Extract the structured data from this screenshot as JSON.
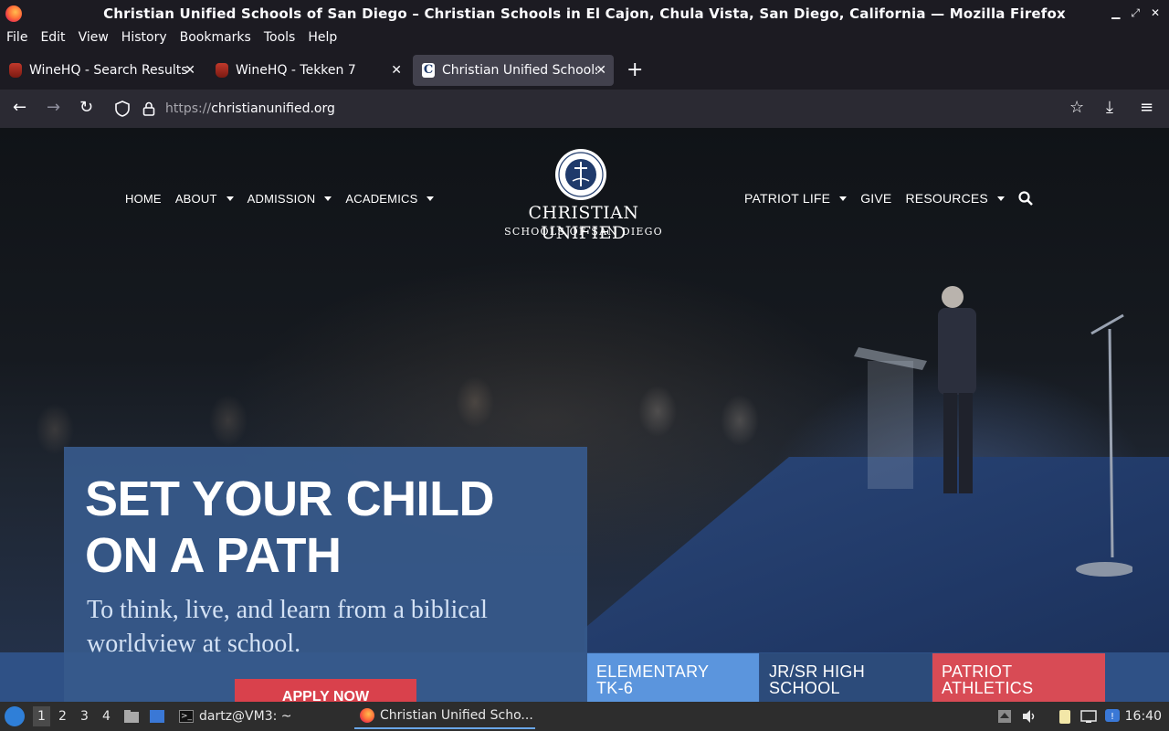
{
  "window": {
    "title": "Christian Unified Schools of San Diego – Christian Schools in El Cajon, Chula Vista, San Diego, California — Mozilla Firefox"
  },
  "menu": [
    "File",
    "Edit",
    "View",
    "History",
    "Bookmarks",
    "Tools",
    "Help"
  ],
  "tabs": [
    {
      "label": "WineHQ - Search Results",
      "favicon": "wine-icon",
      "active": false
    },
    {
      "label": "WineHQ - Tekken 7",
      "favicon": "wine-icon",
      "active": false
    },
    {
      "label": "Christian Unified Schools",
      "favicon": "cus-icon",
      "active": true
    }
  ],
  "urlbar": {
    "protocol": "https://",
    "host": "christianunified.org"
  },
  "site": {
    "nav_left": [
      {
        "label": "HOME",
        "dropdown": false
      },
      {
        "label": "ABOUT",
        "dropdown": true
      },
      {
        "label": "ADMISSION",
        "dropdown": true
      },
      {
        "label": "ACADEMICS",
        "dropdown": true
      }
    ],
    "nav_right": [
      {
        "label": "PATRIOT LIFE",
        "dropdown": true
      },
      {
        "label": "GIVE",
        "dropdown": false
      },
      {
        "label": "RESOURCES",
        "dropdown": true
      }
    ],
    "logo": {
      "name": "CHRISTIAN UNIFIED",
      "sub": "SCHOOLS OF SAN DIEGO"
    },
    "hero": {
      "headline_line1": "SET YOUR CHILD",
      "headline_line2": "ON A PATH",
      "subtitle_line1": "To think, live, and learn from a biblical",
      "subtitle_line2": "worldview at school.",
      "cta": "APPLY NOW"
    },
    "tiles": [
      {
        "line1": "ELEMENTARY",
        "line2": "TK-6"
      },
      {
        "line1": "JR/SR HIGH",
        "line2": "SCHOOL"
      },
      {
        "line1": "PATRIOT",
        "line2": "ATHLETICS"
      }
    ]
  },
  "taskbar": {
    "workspaces": [
      "1",
      "2",
      "3",
      "4"
    ],
    "terminal": "dartz@VM3: ~",
    "firefox_task": "Christian Unified Scho...",
    "clock": "16:40"
  },
  "colors": {
    "hero_card": "#375a8c",
    "apply_button": "#d9414c",
    "tile_elementary": "#5b95dd",
    "tile_high_school": "#2c4b7a",
    "tile_athletics": "#d84b55"
  }
}
